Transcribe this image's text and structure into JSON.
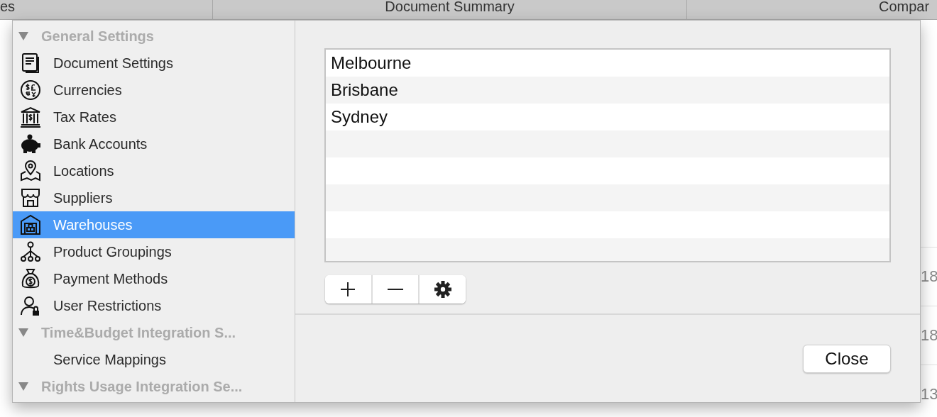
{
  "background": {
    "columns": [
      "es",
      "Document Summary",
      "Compar"
    ],
    "cells": [
      "18",
      "18",
      "13"
    ]
  },
  "sidebar": {
    "groups": [
      {
        "label": "General Settings",
        "expanded": true,
        "children": [
          {
            "label": "Document Settings",
            "selected": false
          },
          {
            "label": "Currencies",
            "selected": false
          },
          {
            "label": "Tax Rates",
            "selected": false
          },
          {
            "label": "Bank Accounts",
            "selected": false
          },
          {
            "label": "Locations",
            "selected": false
          },
          {
            "label": "Suppliers",
            "selected": false
          },
          {
            "label": "Warehouses",
            "selected": true
          },
          {
            "label": "Product Groupings",
            "selected": false
          },
          {
            "label": "Payment Methods",
            "selected": false
          },
          {
            "label": "User Restrictions",
            "selected": false
          }
        ]
      },
      {
        "label": "Time&Budget Integration S...",
        "expanded": true,
        "children": [
          {
            "label": "Service Mappings",
            "selected": false
          }
        ]
      },
      {
        "label": "Rights Usage Integration Se...",
        "expanded": true
      }
    ]
  },
  "list": {
    "items": [
      "Melbourne",
      "Brisbane",
      "Sydney"
    ]
  },
  "buttons": {
    "close": "Close"
  }
}
